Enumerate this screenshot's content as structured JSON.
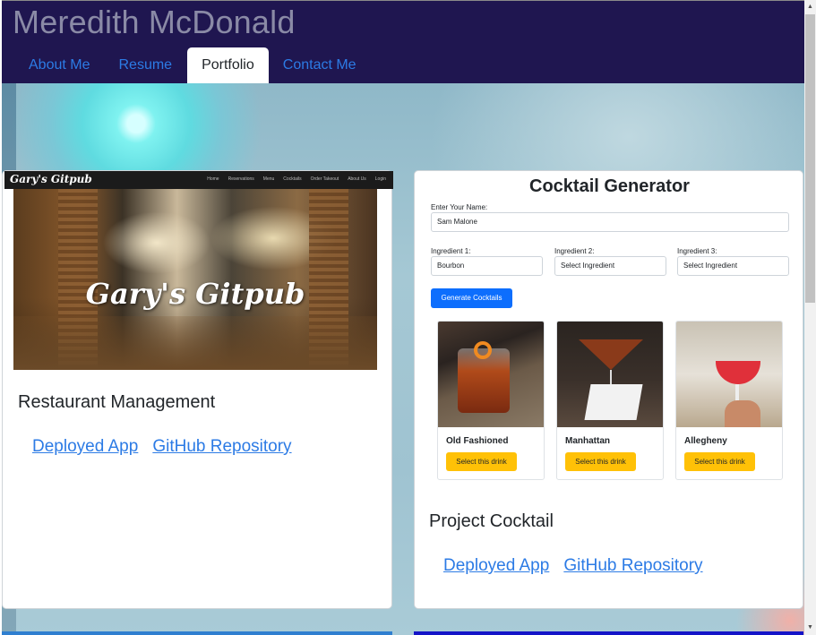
{
  "header": {
    "title": "Meredith McDonald",
    "nav": [
      "About Me",
      "Resume",
      "Portfolio",
      "Contact Me"
    ],
    "active_tab": "Portfolio"
  },
  "projects": [
    {
      "title": "Restaurant Management",
      "links": [
        "Deployed App",
        "GitHub Repository"
      ],
      "screenshot": {
        "logo": "Gary's Gitpub",
        "menu": [
          "Home",
          "Reservations",
          "Menu",
          "Cocktails",
          "Order Takeout",
          "About Us",
          "Login"
        ],
        "hero_text": "Gary's Gitpub"
      }
    },
    {
      "title": "Project Cocktail",
      "links": [
        "Deployed App",
        "GitHub Repository"
      ],
      "screenshot": {
        "heading": "Cocktail Generator",
        "name_label": "Enter Your Name:",
        "name_value": "Sam Malone",
        "ingredients": [
          {
            "label": "Ingredient 1:",
            "value": "Bourbon"
          },
          {
            "label": "Ingredient 2:",
            "value": "Select Ingredient"
          },
          {
            "label": "Ingredient 3:",
            "value": "Select Ingredient"
          }
        ],
        "generate_label": "Generate Cocktails",
        "drinks": [
          {
            "name": "Old Fashioned",
            "button": "Select this drink"
          },
          {
            "name": "Manhattan",
            "button": "Select this drink"
          },
          {
            "name": "Allegheny",
            "button": "Select this drink"
          }
        ]
      }
    }
  ],
  "colors": {
    "header_bg": "#1f1650",
    "link": "#2c7be5",
    "primary_button": "#0d6efd",
    "select_button": "#ffc107"
  },
  "icons": {
    "scroll_up": "▲",
    "scroll_down": "▼"
  }
}
